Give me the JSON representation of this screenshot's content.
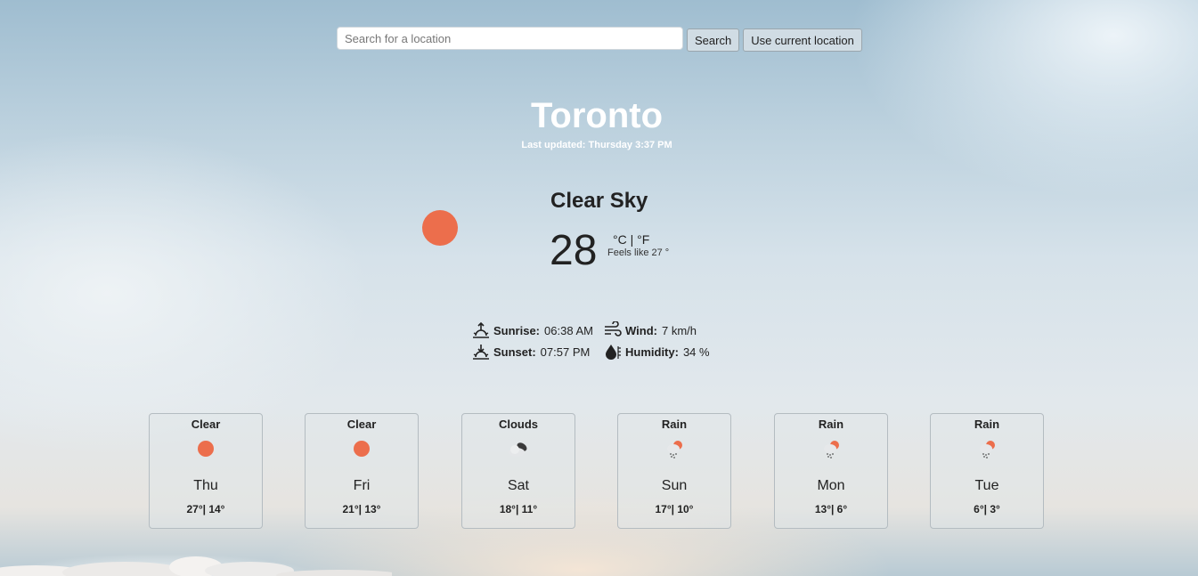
{
  "search": {
    "placeholder": "Search for a location",
    "value": "",
    "search_label": "Search",
    "location_label": "Use current location"
  },
  "header": {
    "city": "Toronto",
    "updated": "Last updated: Thursday 3:37 PM"
  },
  "current": {
    "condition": "Clear Sky",
    "temp": "28",
    "units": "°C | °F",
    "feels_like": "Feels like 27 °",
    "icon": "sun-icon",
    "icon_color": "#ec6e4c"
  },
  "details": {
    "sunrise": {
      "label": "Sunrise:",
      "value": "06:38 AM",
      "icon": "sunrise-icon"
    },
    "sunset": {
      "label": "Sunset:",
      "value": "07:57 PM",
      "icon": "sunset-icon"
    },
    "wind": {
      "label": "Wind:",
      "value": "7 km/h",
      "icon": "wind-icon"
    },
    "humidity": {
      "label": "Humidity:",
      "value": "34 %",
      "icon": "humidity-icon"
    }
  },
  "forecast": [
    {
      "condition": "Clear",
      "day": "Thu",
      "temps": "27°| 14°",
      "icon": "sun-icon"
    },
    {
      "condition": "Clear",
      "day": "Fri",
      "temps": "21°| 13°",
      "icon": "sun-icon"
    },
    {
      "condition": "Clouds",
      "day": "Sat",
      "temps": "18°| 11°",
      "icon": "clouds-icon"
    },
    {
      "condition": "Rain",
      "day": "Sun",
      "temps": "17°| 10°",
      "icon": "rain-icon"
    },
    {
      "condition": "Rain",
      "day": "Mon",
      "temps": "13°| 6°",
      "icon": "rain-icon"
    },
    {
      "condition": "Rain",
      "day": "Tue",
      "temps": "6°| 3°",
      "icon": "rain-icon"
    }
  ]
}
